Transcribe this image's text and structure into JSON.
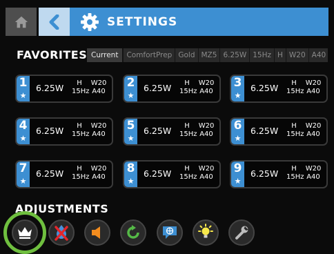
{
  "header": {
    "title": "SETTINGS",
    "home_icon": "home-icon",
    "back_icon": "back-chevron-icon",
    "settings_icon": "gear-icon"
  },
  "favorites": {
    "title": "FAVORITES",
    "tabs": {
      "current": "Current",
      "items": [
        "ComfortPrep",
        "Gold",
        "MZ5",
        "6.25W",
        "15Hz",
        "H",
        "W20",
        "A40"
      ]
    },
    "cards": [
      {
        "number": "1",
        "power": "6.25W",
        "top1": "H",
        "bottom1": "15Hz",
        "top2": "W20",
        "bottom2": "A40"
      },
      {
        "number": "2",
        "power": "6.25W",
        "top1": "H",
        "bottom1": "15Hz",
        "top2": "W20",
        "bottom2": "A40"
      },
      {
        "number": "3",
        "power": "6.25W",
        "top1": "H",
        "bottom1": "15Hz",
        "top2": "W20",
        "bottom2": "A40"
      },
      {
        "number": "4",
        "power": "6.25W",
        "top1": "H",
        "bottom1": "15Hz",
        "top2": "W20",
        "bottom2": "A40"
      },
      {
        "number": "5",
        "power": "6.25W",
        "top1": "H",
        "bottom1": "15Hz",
        "top2": "W20",
        "bottom2": "A40"
      },
      {
        "number": "6",
        "power": "6.25W",
        "top1": "H",
        "bottom1": "15Hz",
        "top2": "W20",
        "bottom2": "A40"
      },
      {
        "number": "7",
        "power": "6.25W",
        "top1": "H",
        "bottom1": "15Hz",
        "top2": "W20",
        "bottom2": "A40"
      },
      {
        "number": "8",
        "power": "6.25W",
        "top1": "H",
        "bottom1": "15Hz",
        "top2": "W20",
        "bottom2": "A40"
      },
      {
        "number": "9",
        "power": "6.25W",
        "top1": "H",
        "bottom1": "15Hz",
        "top2": "W20",
        "bottom2": "A40"
      }
    ]
  },
  "adjustments": {
    "title": "ADJUSTMENTS",
    "buttons": [
      "crown-icon",
      "water-off-icon",
      "speaker-icon",
      "refresh-icon",
      "language-icon",
      "brightness-icon",
      "wrench-icon"
    ],
    "highlighted": "crown-icon",
    "colors": {
      "highlight": "#6fbf3f",
      "water_off": "#e4262b",
      "speaker": "#f28c1e",
      "refresh": "#55b947",
      "language": "#3d8fd2",
      "brightness": "#f7e84a"
    }
  },
  "colors": {
    "accent": "#3d8fd2",
    "background": "#0b0b0b"
  }
}
